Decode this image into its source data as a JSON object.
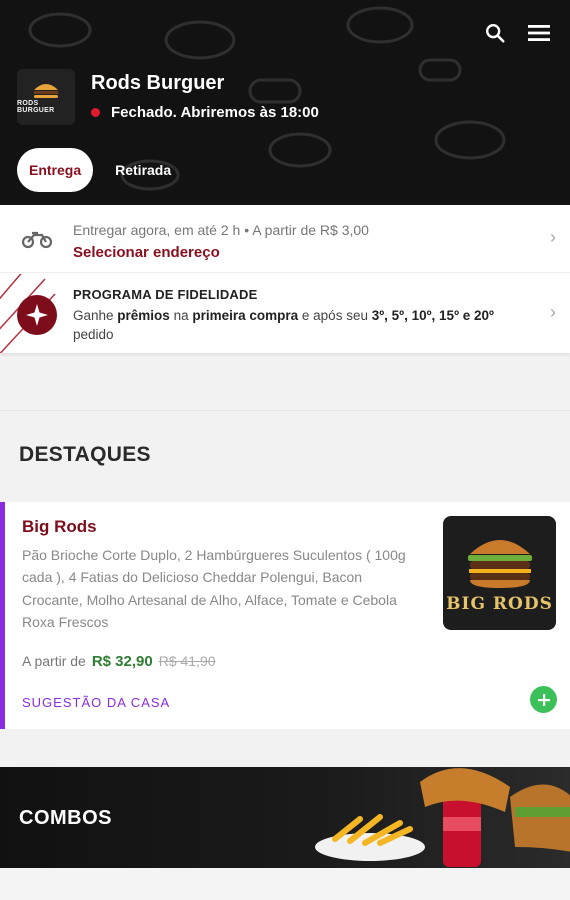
{
  "header": {
    "logo_text": "RODS BURGUER",
    "store_name": "Rods Burguer",
    "status_text": "Fechado. Abriremos às 18:00",
    "status_color": "#e0192f",
    "tabs": [
      {
        "label": "Entrega",
        "active": true
      },
      {
        "label": "Retirada",
        "active": false
      }
    ],
    "icons": [
      "search-icon",
      "menu-icon"
    ]
  },
  "delivery": {
    "info": "Entregar agora, em até 2 h  •  A partir de R$ 3,00",
    "link": "Selecionar endereço"
  },
  "loyalty": {
    "title": "PROGRAMA DE FIDELIDADE",
    "desc_part1": "Ganhe ",
    "desc_bold1": "prêmios",
    "desc_part2": " na ",
    "desc_bold2": "primeira compra",
    "desc_part3": " e após seu ",
    "desc_bold3": "3º, 5º, 10º, 15º e 20º",
    "desc_part4": " pedido"
  },
  "highlights": {
    "title": "DESTAQUES",
    "product": {
      "name": "Big Rods",
      "description": "Pão Brioche Corte Duplo, 2 Hambúrgueres Suculentos ( 100g cada ), 4 Fatias do Delicioso Cheddar Polengui, Bacon Crocante, Molho Artesanal de Alho, Alface, Tomate e Cebola Roxa Frescos",
      "price_prefix": "A partir de",
      "price": "R$ 32,90",
      "old_price": "R$ 41,90",
      "image_label": "BIG RODS",
      "tag": "SUGESTÃO DA CASA"
    }
  },
  "combos": {
    "title": "COMBOS"
  },
  "colors": {
    "brand": "#8a0f1e",
    "accent_purple": "#8a2be2",
    "price_green": "#2e7d32",
    "add_green": "#3cc15a"
  }
}
